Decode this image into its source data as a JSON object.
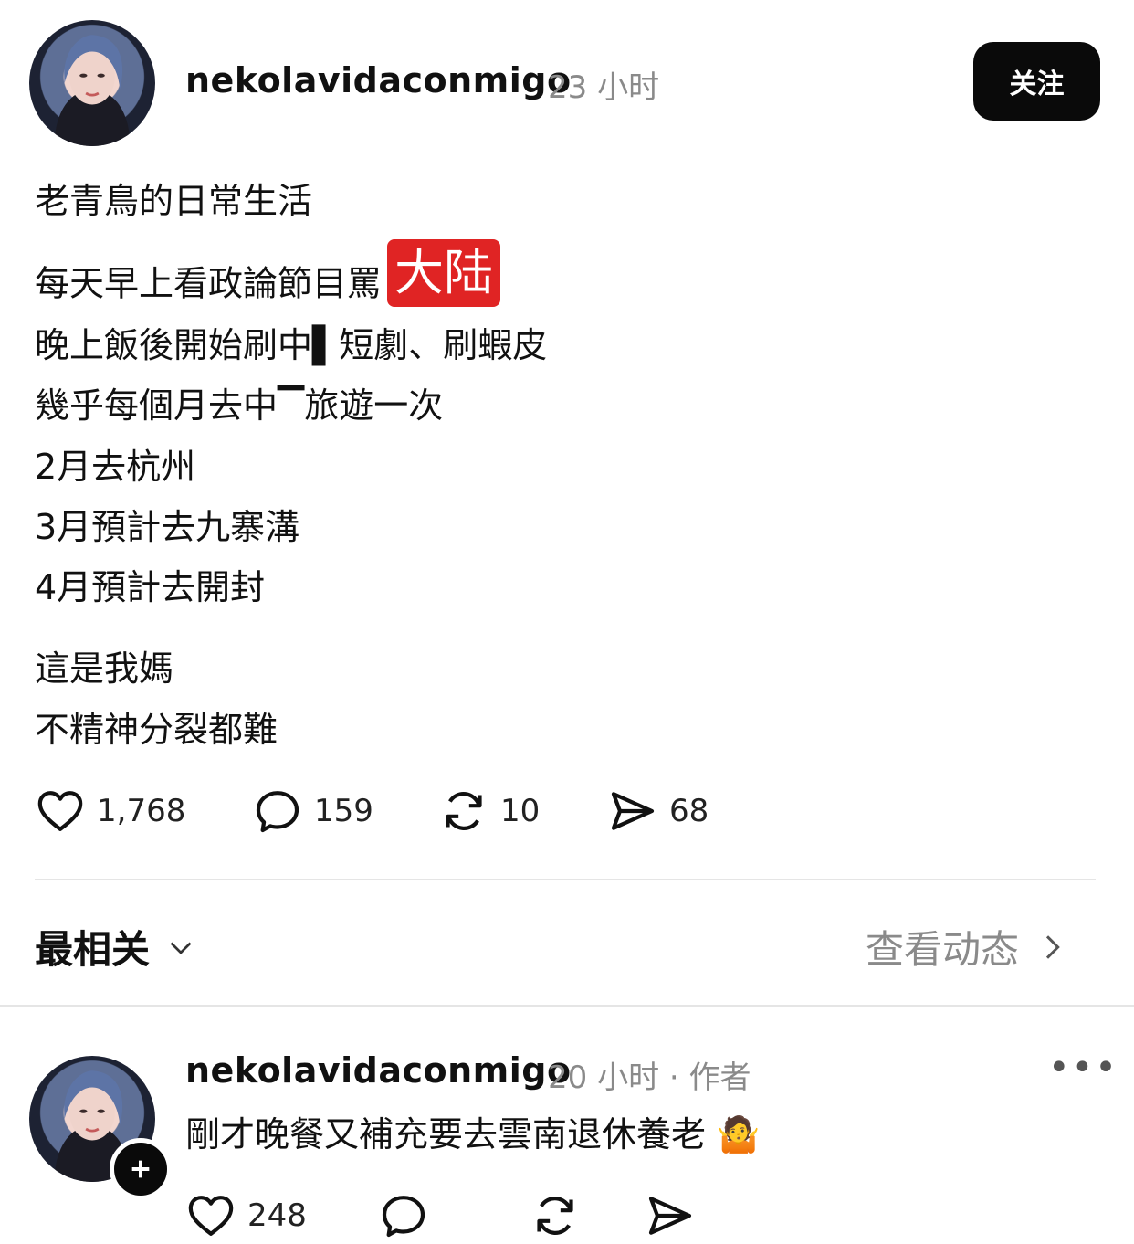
{
  "post": {
    "username": "nekolavidaconmigo",
    "time": "23 小时",
    "follow_label": "关注",
    "highlight": "大陆",
    "lines": [
      "老青鳥的日常生活",
      "每天早上看政論節目罵",
      "晚上飯後開始刷中▌短劇、刷蝦皮",
      "幾乎每個月去中▔旅遊一次",
      "2月去杭州",
      "3月預計去九寨溝",
      "4月預計去開封",
      "這是我媽",
      "不精神分裂都難"
    ],
    "stats": {
      "likes": "1,768",
      "comments": "159",
      "reposts": "10",
      "shares": "68"
    }
  },
  "replies_header": {
    "sort_label": "最相关",
    "activity_label": "查看动态"
  },
  "reply": {
    "username": "nekolavidaconmigo",
    "meta": "20 小时 · 作者",
    "text": "剛才晚餐又補充要去雲南退休養老 🤷",
    "likes": "248"
  }
}
